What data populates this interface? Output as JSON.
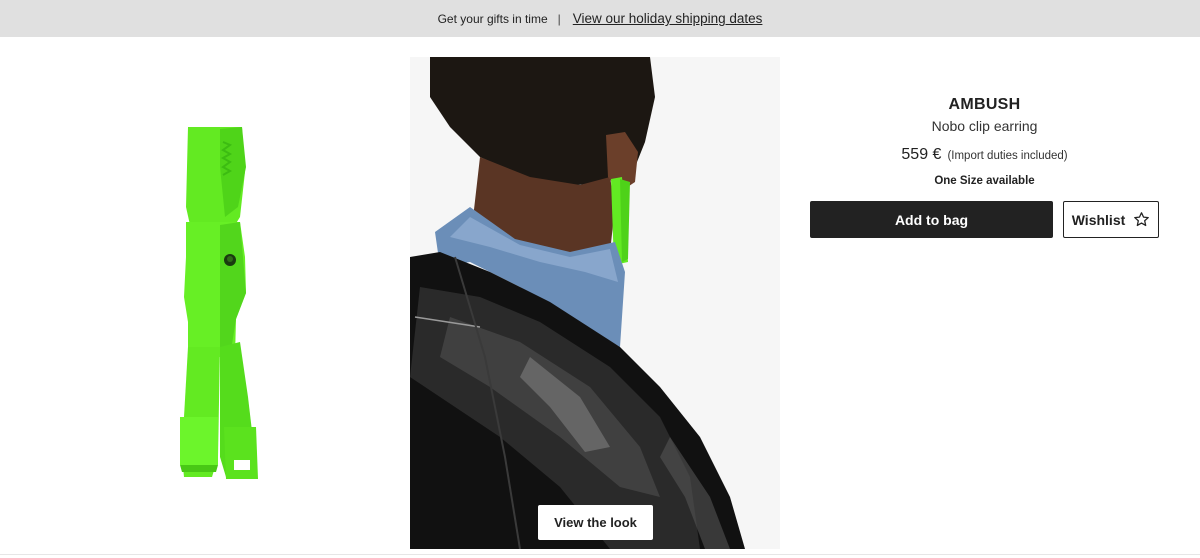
{
  "promo": {
    "text": "Get your gifts in time",
    "separator": "|",
    "link": "View our holiday shipping dates"
  },
  "gallery": {
    "view_look_label": "View the look",
    "product_color": "#6ef52a"
  },
  "product": {
    "brand": "AMBUSH",
    "name": "Nobo clip earring",
    "price": "559 €",
    "duties": "(Import duties included)",
    "size_availability": "One Size available"
  },
  "actions": {
    "add_to_bag": "Add to bag",
    "wishlist": "Wishlist",
    "wishlist_icon": "star-outline-icon"
  }
}
